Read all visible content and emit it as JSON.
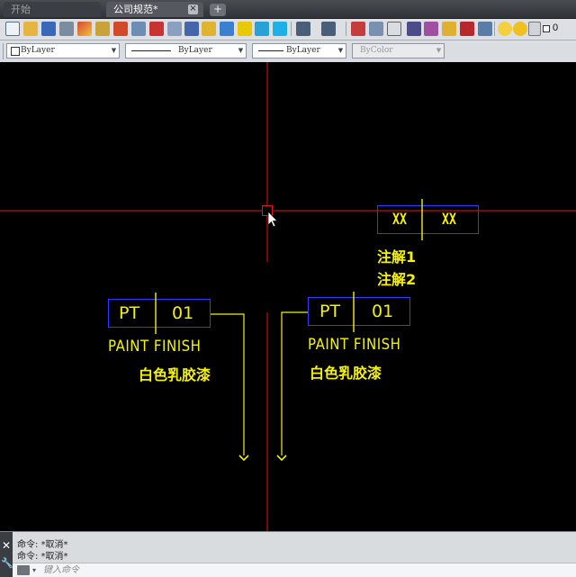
{
  "tabs": {
    "start_label": "开始",
    "doc_label": "公司规范*",
    "close_glyph": "×",
    "new_glyph": "+"
  },
  "toolbar": {
    "icons": [
      "new-icon",
      "open-icon",
      "save-icon",
      "plot-icon",
      "matchprop-icon",
      "design-center-icon",
      "properties-icon",
      "tool-palette-icon",
      "sheet-set-icon",
      "markup-icon",
      "quickcalc-icon",
      "block-icon",
      "insert-block-icon",
      "image-icon",
      "edit-icon",
      "text-icon",
      "table-icon",
      "hatch-icon",
      "undo-icon",
      "redo-icon",
      "layer-icon",
      "layer-states-icon",
      "layer-match-icon",
      "isolate-icon",
      "walk-icon",
      "measure-icon",
      "list-icon",
      "light-icon",
      "sun-icon",
      "layer-zero-icon"
    ],
    "layer_value": "0"
  },
  "properties": {
    "color_value": "ByLayer",
    "linetype_value": "ByLayer",
    "lineweight_value": "ByLayer",
    "plotstyle_value": "ByColor"
  },
  "drawing": {
    "tag_left": {
      "code": "PT",
      "number": "01",
      "caption": "PAINT FINISH",
      "note": "白色乳胶漆"
    },
    "tag_right": {
      "code": "PT",
      "number": "01",
      "caption": "PAINT FINISH",
      "note": "白色乳胶漆"
    },
    "tag_top": {
      "left": "XX",
      "right": "XX",
      "note_1": "注解1",
      "note_2": "注解2"
    },
    "colors": {
      "crosshair": "#e0141e",
      "annotation": "#f7f300",
      "frame": "#2c3cff",
      "background": "#000000"
    }
  },
  "command": {
    "history": [
      "命令: *取消*",
      "命令: *取消*"
    ],
    "placeholder": "键入命令",
    "close_glyph": "✕",
    "settings_glyph": "🔧",
    "dropdown_glyph": "▾"
  }
}
